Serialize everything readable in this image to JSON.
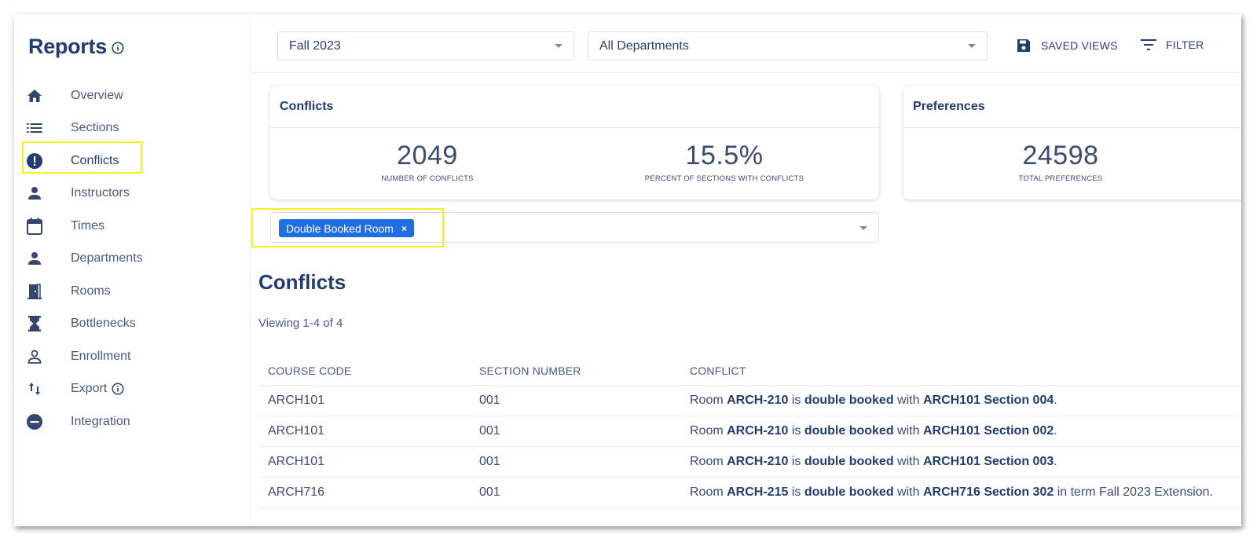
{
  "sidebar": {
    "title": "Reports",
    "items": [
      {
        "label": "Overview",
        "icon": "home-icon"
      },
      {
        "label": "Sections",
        "icon": "list-icon"
      },
      {
        "label": "Conflicts",
        "icon": "alert-circle-icon"
      },
      {
        "label": "Instructors",
        "icon": "person-icon"
      },
      {
        "label": "Times",
        "icon": "calendar-icon"
      },
      {
        "label": "Departments",
        "icon": "person-icon"
      },
      {
        "label": "Rooms",
        "icon": "door-icon"
      },
      {
        "label": "Bottlenecks",
        "icon": "hourglass-icon"
      },
      {
        "label": "Enrollment",
        "icon": "person-outline-icon"
      },
      {
        "label": "Export",
        "icon": "sort-arrows-icon"
      },
      {
        "label": "Integration",
        "icon": "minus-circle-icon"
      }
    ],
    "active": "Conflicts"
  },
  "topbar": {
    "term_select": "Fall 2023",
    "department_select": "All Departments",
    "saved_views_label": "SAVED VIEWS",
    "filter_label": "FILTER"
  },
  "cards": {
    "conflicts": {
      "title": "Conflicts",
      "stats": [
        {
          "value": "2049",
          "label": "NUMBER OF CONFLICTS"
        },
        {
          "value": "15.5%",
          "label": "PERCENT OF SECTIONS WITH CONFLICTS"
        }
      ]
    },
    "preferences": {
      "title": "Preferences",
      "stats": [
        {
          "value": "24598",
          "label": "TOTAL PREFERENCES"
        }
      ]
    }
  },
  "filter": {
    "chip_label": "Double Booked Room",
    "chip_close": "×"
  },
  "main": {
    "section_title": "Conflicts",
    "viewing_text": "Viewing 1-4 of 4"
  },
  "table": {
    "headers": [
      "COURSE CODE",
      "SECTION NUMBER",
      "CONFLICT"
    ],
    "rows": [
      {
        "course": "ARCH101",
        "section": "001",
        "conflict": {
          "pre": "Room ",
          "room": "ARCH-210",
          "mid": " is ",
          "kind": "double booked",
          "with": " with ",
          "target": "ARCH101 Section 004",
          "post": "."
        }
      },
      {
        "course": "ARCH101",
        "section": "001",
        "conflict": {
          "pre": "Room ",
          "room": "ARCH-210",
          "mid": " is ",
          "kind": "double booked",
          "with": " with ",
          "target": "ARCH101 Section 002",
          "post": "."
        }
      },
      {
        "course": "ARCH101",
        "section": "001",
        "conflict": {
          "pre": "Room ",
          "room": "ARCH-210",
          "mid": " is ",
          "kind": "double booked",
          "with": " with ",
          "target": "ARCH101 Section 003",
          "post": "."
        }
      },
      {
        "course": "ARCH716",
        "section": "001",
        "conflict": {
          "pre": "Room ",
          "room": "ARCH-215",
          "mid": " is ",
          "kind": "double booked",
          "with": " with ",
          "target": "ARCH716 Section 302",
          "post": " in term Fall 2023 Extension."
        }
      }
    ]
  },
  "colors": {
    "primary_text": "#233b6e",
    "chip_bg": "#1f6fe0",
    "highlight": "#f2f21a"
  }
}
